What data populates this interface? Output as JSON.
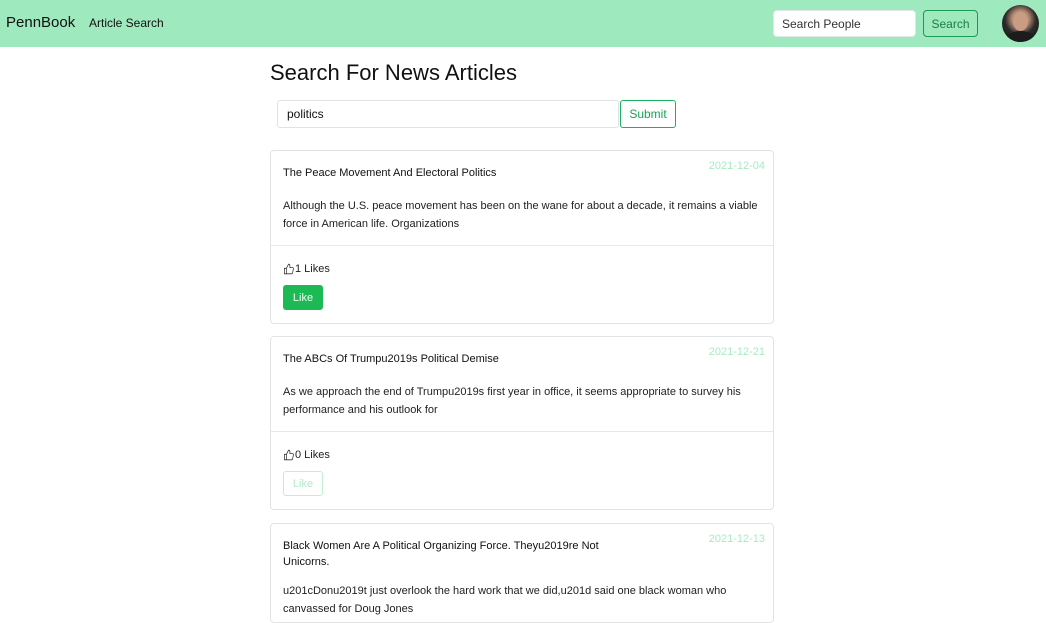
{
  "navbar": {
    "brand": "PennBook",
    "link": "Article Search",
    "search_placeholder": "Search People",
    "search_button": "Search"
  },
  "main": {
    "title": "Search For News Articles",
    "query_value": "politics",
    "submit_label": "Submit"
  },
  "articles": [
    {
      "title": "The Peace Movement And Electoral Politics",
      "date": "2021-12-04",
      "text": "Although the U.S. peace movement has been on the wane for about a decade, it remains a viable force in American life. Organizations",
      "likes": "1 Likes",
      "like_label": "Like"
    },
    {
      "title": "The ABCs Of Trumpu2019s Political Demise",
      "date": "2021-12-21",
      "text": "As we approach the end of Trumpu2019s first year in office, it seems appropriate to survey his performance and his outlook for",
      "likes": "0 Likes",
      "like_label": "Like"
    },
    {
      "title": "Black Women Are A Political Organizing Force. Theyu2019re Not Unicorns.",
      "date": "2021-12-13",
      "text": "u201cDonu2019t just overlook the hard work that we did,u201d said one black woman who canvassed for Doug Jones"
    }
  ],
  "colors": {
    "navbar_bg": "#9ee9bd",
    "accent": "#1db954",
    "date": "#a8ebc4"
  }
}
